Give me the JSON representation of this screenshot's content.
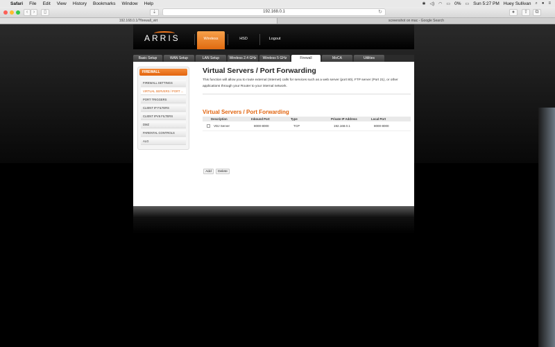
{
  "menubar": {
    "app": "Safari",
    "items": [
      "File",
      "Edit",
      "View",
      "History",
      "Bookmarks",
      "Window",
      "Help"
    ],
    "battery": "0%",
    "clock": "Sun 5:27 PM",
    "user": "Huey Sullivan"
  },
  "browser": {
    "url": "192.168.0.1",
    "tabs": [
      "192.168.0.1/?firewall_virt",
      "screenshot on mac - Google Search"
    ]
  },
  "router": {
    "logo": "ARRIS",
    "top_nav": [
      "Wireless",
      "HSD",
      "Logout"
    ],
    "tabs": [
      "Basic Setup",
      "WAN Setup",
      "LAN Setup",
      "Wireless 2.4 GHz",
      "Wireless 5 GHz",
      "Firewall",
      "MoCA",
      "Utilities"
    ],
    "active_tab": "Firewall",
    "colors": {
      "accent": "#e2640e",
      "frame": "#000000"
    }
  },
  "sidebar": {
    "header": "FIREWALL",
    "items": [
      "FIREWALL SETTINGS",
      "VIRTUAL SERVERS / PORT ...",
      "PORT TRIGGERS",
      "CLIENT IP FILTERS",
      "CLIENT IPV6 FILTERS",
      "DMZ",
      "PARENTAL CONTROLS",
      "ALG"
    ]
  },
  "main": {
    "title": "Virtual Servers / Port Forwarding",
    "desc": "This function will allow you to route external (Internet) calls for services such as a web server (port 80), FTP server (Port 21), or other applications through your Router to your internal network.",
    "section_title": "Virtual Servers / Port Forwarding",
    "columns": [
      "Description",
      "Inbound Port",
      "Type",
      "Private IP Address",
      "Local Port"
    ],
    "rows": [
      {
        "description": "VDJ Server",
        "inbound_port": "8000-8000",
        "type": "TCP",
        "ip": "192.168.0.1",
        "local_port": "8000-8000"
      }
    ],
    "add_label": "Add",
    "delete_label": "Delete"
  }
}
